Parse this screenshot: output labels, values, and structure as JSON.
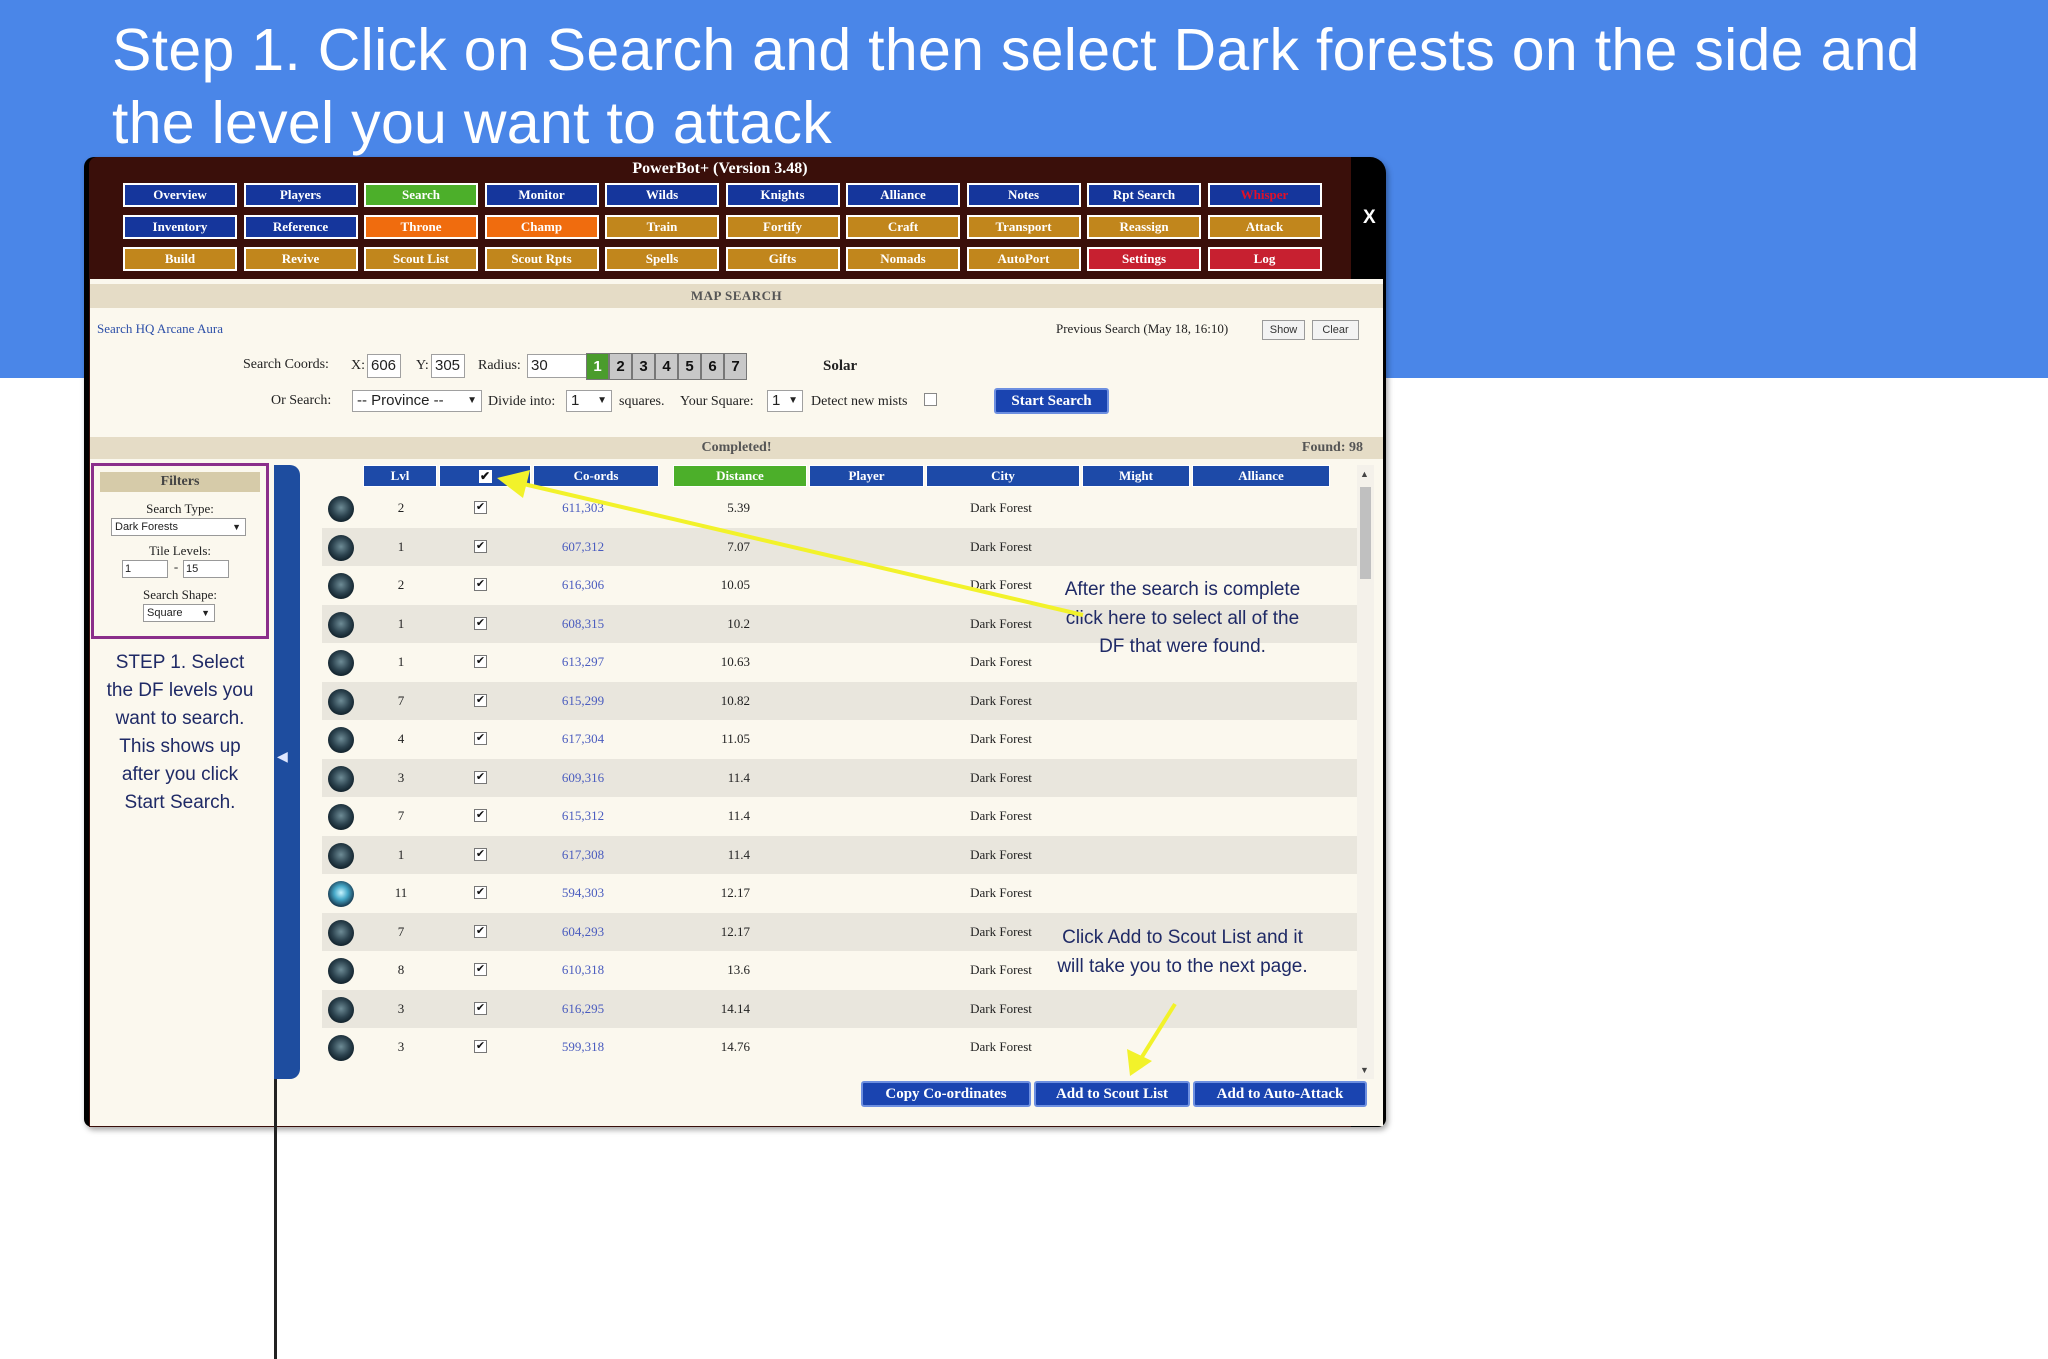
{
  "slide": {
    "title": "Step 1.  Click on Search and then select Dark forests on the side and the level you want to attack"
  },
  "window": {
    "title": "PowerBot+ (Version 3.48)",
    "close_label": "X"
  },
  "nav": {
    "rows": [
      [
        {
          "label": "Overview",
          "style": "blue"
        },
        {
          "label": "Players",
          "style": "blue"
        },
        {
          "label": "Search",
          "style": "green"
        },
        {
          "label": "Monitor",
          "style": "blue"
        },
        {
          "label": "Wilds",
          "style": "blue"
        },
        {
          "label": "Knights",
          "style": "blue"
        },
        {
          "label": "Alliance",
          "style": "blue"
        },
        {
          "label": "Notes",
          "style": "blue"
        },
        {
          "label": "Rpt Search",
          "style": "blue"
        },
        {
          "label": "Whisper",
          "style": "redtxt"
        }
      ],
      [
        {
          "label": "Inventory",
          "style": "blue"
        },
        {
          "label": "Reference",
          "style": "blue"
        },
        {
          "label": "Throne",
          "style": "orange"
        },
        {
          "label": "Champ",
          "style": "orange"
        },
        {
          "label": "Train",
          "style": "gold"
        },
        {
          "label": "Fortify",
          "style": "gold"
        },
        {
          "label": "Craft",
          "style": "gold"
        },
        {
          "label": "Transport",
          "style": "gold"
        },
        {
          "label": "Reassign",
          "style": "gold"
        },
        {
          "label": "Attack",
          "style": "gold"
        }
      ],
      [
        {
          "label": "Build",
          "style": "gold"
        },
        {
          "label": "Revive",
          "style": "gold"
        },
        {
          "label": "Scout List",
          "style": "gold"
        },
        {
          "label": "Scout Rpts",
          "style": "gold"
        },
        {
          "label": "Spells",
          "style": "gold"
        },
        {
          "label": "Gifts",
          "style": "gold"
        },
        {
          "label": "Nomads",
          "style": "gold"
        },
        {
          "label": "AutoPort",
          "style": "gold"
        },
        {
          "label": "Settings",
          "style": "red"
        },
        {
          "label": "Log",
          "style": "red"
        }
      ]
    ]
  },
  "map_search": {
    "header": "MAP SEARCH",
    "search_hq": "Search HQ Arcane Aura",
    "previous_search": "Previous Search (May 18, 16:10)",
    "show_label": "Show",
    "clear_label": "Clear",
    "coords_label": "Search Coords:",
    "x_label": "X:",
    "x_value": "606",
    "y_label": "Y:",
    "y_value": "305",
    "radius_label": "Radius:",
    "radius_value": "30",
    "level_buttons": [
      "1",
      "2",
      "3",
      "4",
      "5",
      "6",
      "7"
    ],
    "solar_label": "Solar",
    "or_search_label": "Or Search:",
    "province_value": "-- Province --",
    "divide_label": "Divide into:",
    "divide_value": "1",
    "squares_label": "squares.",
    "your_square_label": "Your Square:",
    "your_square_value": "1",
    "detect_label": "Detect new mists",
    "start_label": "Start Search",
    "completed_label": "Completed!",
    "found_label": "Found: 98"
  },
  "filters": {
    "header": "Filters",
    "search_type_label": "Search Type:",
    "search_type_value": "Dark Forests",
    "tile_levels_label": "Tile Levels:",
    "tile_min": "1",
    "tile_dash": "-",
    "tile_max": "15",
    "search_shape_label": "Search Shape:",
    "search_shape_value": "Square"
  },
  "table": {
    "headers": [
      "Lvl",
      "",
      "Co-ords",
      "Distance",
      "Player",
      "City",
      "Might",
      "Alliance"
    ],
    "rows": [
      {
        "lvl": "2",
        "coords": "611,303",
        "distance": "5.39",
        "city": "Dark Forest"
      },
      {
        "lvl": "1",
        "coords": "607,312",
        "distance": "7.07",
        "city": "Dark Forest"
      },
      {
        "lvl": "2",
        "coords": "616,306",
        "distance": "10.05",
        "city": "Dark Forest"
      },
      {
        "lvl": "1",
        "coords": "608,315",
        "distance": "10.2",
        "city": "Dark Forest"
      },
      {
        "lvl": "1",
        "coords": "613,297",
        "distance": "10.63",
        "city": "Dark Forest"
      },
      {
        "lvl": "7",
        "coords": "615,299",
        "distance": "10.82",
        "city": "Dark Forest"
      },
      {
        "lvl": "4",
        "coords": "617,304",
        "distance": "11.05",
        "city": "Dark Forest"
      },
      {
        "lvl": "3",
        "coords": "609,316",
        "distance": "11.4",
        "city": "Dark Forest"
      },
      {
        "lvl": "7",
        "coords": "615,312",
        "distance": "11.4",
        "city": "Dark Forest"
      },
      {
        "lvl": "1",
        "coords": "617,308",
        "distance": "11.4",
        "city": "Dark Forest"
      },
      {
        "lvl": "11",
        "coords": "594,303",
        "distance": "12.17",
        "city": "Dark Forest"
      },
      {
        "lvl": "7",
        "coords": "604,293",
        "distance": "12.17",
        "city": "Dark Forest"
      },
      {
        "lvl": "8",
        "coords": "610,318",
        "distance": "13.6",
        "city": "Dark Forest"
      },
      {
        "lvl": "3",
        "coords": "616,295",
        "distance": "14.14",
        "city": "Dark Forest"
      },
      {
        "lvl": "3",
        "coords": "599,318",
        "distance": "14.76",
        "city": "Dark Forest"
      }
    ]
  },
  "actions": {
    "copy_label": "Copy Co-ordinates",
    "scout_label": "Add to Scout List",
    "auto_attack_label": "Add to Auto-Attack"
  },
  "annotations": {
    "step_note": "STEP 1.  Select the DF levels you want to search. This shows up after you click Start Search.",
    "select_all_note": "After the search is complete click here to select all of the DF that were found.",
    "scout_note": "Click Add to Scout List and it will take you to the next page.",
    "arrow_color": "#f2f22a"
  },
  "colors": {
    "banner": "#4a86e8",
    "header_blue": "#1d4aa8",
    "active_green": "#4caf2a",
    "filter_border": "#8b2f8b"
  }
}
